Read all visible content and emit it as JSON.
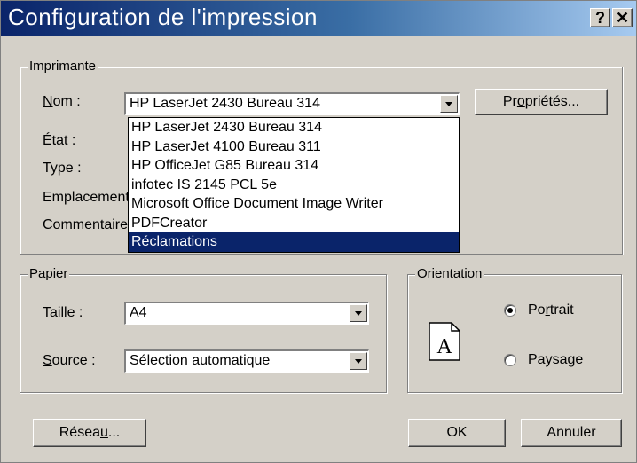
{
  "window": {
    "title": "Configuration de l'impression",
    "help_label": "?",
    "close_label": "✕"
  },
  "printer": {
    "group_label": "Imprimante",
    "name_label": "Nom :",
    "name_value": "HP LaserJet 2430 Bureau 314",
    "properties_label": "Propriétés...",
    "state_label": "État :",
    "type_label": "Type :",
    "location_label": "Emplacement",
    "comment_label": "Commentaire",
    "options": [
      "HP LaserJet 2430 Bureau 314",
      "HP LaserJet 4100 Bureau 311",
      "HP OfficeJet G85 Bureau 314",
      "infotec  IS 2145 PCL 5e",
      "Microsoft Office Document Image Writer",
      "PDFCreator",
      "Réclamations"
    ],
    "highlighted_option": "Réclamations"
  },
  "paper": {
    "group_label": "Papier",
    "size_label": "Taille :",
    "size_value": "A4",
    "source_label": "Source :",
    "source_value": "Sélection automatique"
  },
  "orientation": {
    "group_label": "Orientation",
    "icon_letter": "A",
    "portrait_label": "Portrait",
    "landscape_label": "Paysage",
    "selected": "Portrait"
  },
  "buttons": {
    "network_label": "Réseau...",
    "ok_label": "OK",
    "cancel_label": "Annuler"
  }
}
